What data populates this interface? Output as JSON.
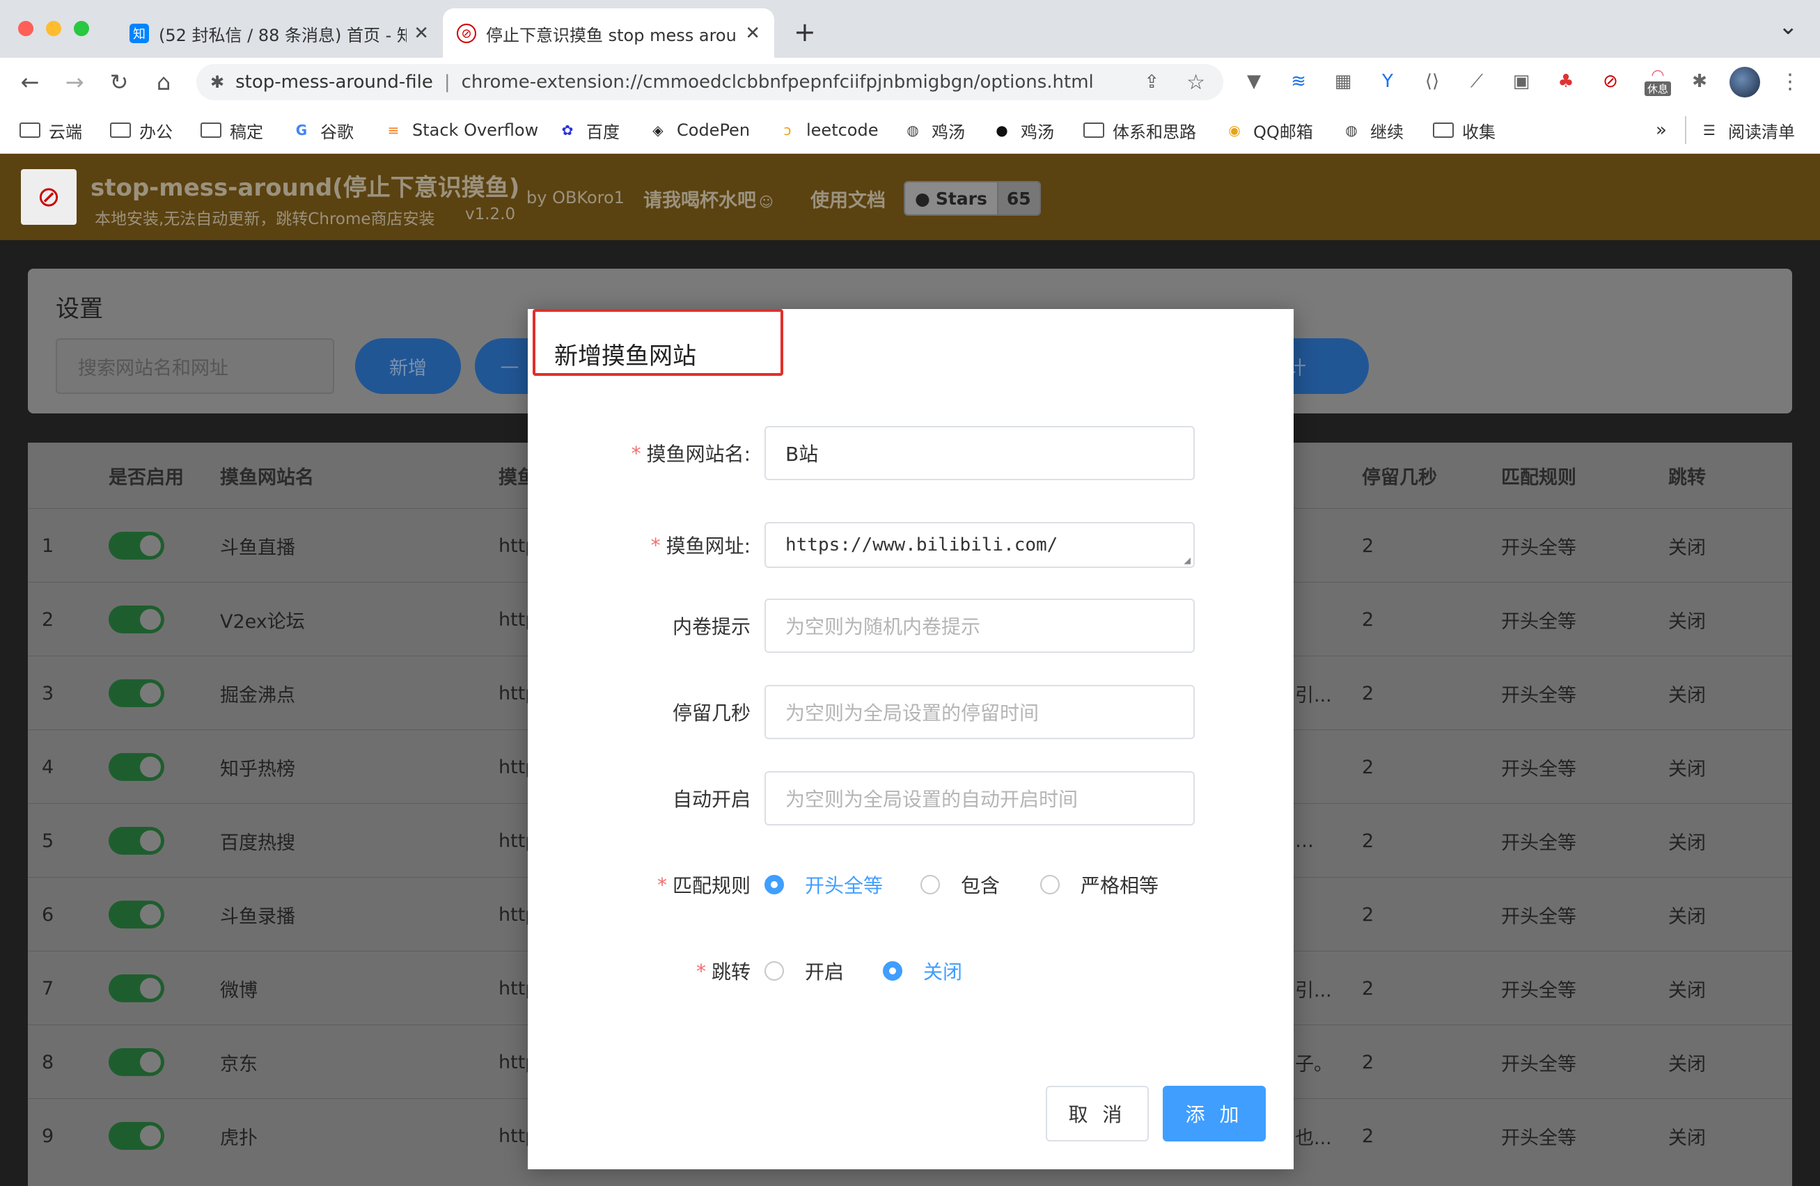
{
  "browser": {
    "tabs": [
      {
        "title": "(52 封私信 / 88 条消息) 首页 - 知",
        "favicon": "知"
      },
      {
        "title": "停止下意识摸鱼 stop mess arou",
        "favicon": "stop-icon"
      }
    ],
    "new_tab": "+",
    "dropdown": "⌄",
    "url_site": "stop-mess-around-file",
    "url_path": "chrome-extension://cmmoedclcbbnfpepnfciifpjnbmigbgn/options.html",
    "ext_badge": "休息"
  },
  "bookmarks": [
    {
      "label": "云端",
      "icon": "folder"
    },
    {
      "label": "办公",
      "icon": "folder"
    },
    {
      "label": "稿定",
      "icon": "folder"
    },
    {
      "label": "谷歌",
      "icon": "G"
    },
    {
      "label": "Stack Overflow",
      "icon": "stackoverflow"
    },
    {
      "label": "百度",
      "icon": "baidu"
    },
    {
      "label": "CodePen",
      "icon": "codepen"
    },
    {
      "label": "leetcode",
      "icon": "leetcode"
    },
    {
      "label": "鸡汤",
      "icon": "globe"
    },
    {
      "label": "鸡汤",
      "icon": "github"
    },
    {
      "label": "体系和思路",
      "icon": "folder"
    },
    {
      "label": "QQ邮箱",
      "icon": "qqmail"
    },
    {
      "label": "继续",
      "icon": "globe"
    },
    {
      "label": "收集",
      "icon": "folder"
    }
  ],
  "bookmarks_more": "»",
  "reading_list": "阅读清单",
  "app": {
    "title": "stop-mess-around(停止下意识摸鱼)",
    "subtitle": "本地安装,无法自动更新，跳转Chrome商店安装",
    "version": "v1.2.0",
    "author": "by OBKoro1",
    "coffee": "请我喝杯水吧",
    "docs": "使用文档",
    "stars_label": "Stars",
    "stars_count": "65"
  },
  "settings": {
    "title": "设置",
    "search_placeholder": "搜索网站名和网址",
    "add_button": "新增",
    "partial_button": "—",
    "stats_button": "统计"
  },
  "table": {
    "headers": [
      "是否启用",
      "摸鱼网站名",
      "摸鱼",
      "停留几秒",
      "匹配规则",
      "跳转"
    ],
    "rows": [
      {
        "idx": "1",
        "name": "斗鱼直播",
        "url": "http",
        "extra": "",
        "secs": "2",
        "rule": "开头全等",
        "jump": "关闭"
      },
      {
        "idx": "2",
        "name": "V2ex论坛",
        "url": "http",
        "extra": "",
        "secs": "2",
        "rule": "开头全等",
        "jump": "关闭"
      },
      {
        "idx": "3",
        "name": "掘金沸点",
        "url": "http",
        "extra": "引...",
        "secs": "2",
        "rule": "开头全等",
        "jump": "关闭"
      },
      {
        "idx": "4",
        "name": "知乎热榜",
        "url": "http",
        "extra": "",
        "secs": "2",
        "rule": "开头全等",
        "jump": "关闭"
      },
      {
        "idx": "5",
        "name": "百度热搜",
        "url": "http",
        "extra": "…",
        "secs": "2",
        "rule": "开头全等",
        "jump": "关闭"
      },
      {
        "idx": "6",
        "name": "斗鱼录播",
        "url": "http",
        "extra": "",
        "secs": "2",
        "rule": "开头全等",
        "jump": "关闭"
      },
      {
        "idx": "7",
        "name": "微博",
        "url": "http",
        "extra": "引...",
        "secs": "2",
        "rule": "开头全等",
        "jump": "关闭"
      },
      {
        "idx": "8",
        "name": "京东",
        "url": "http",
        "extra": "子。",
        "secs": "2",
        "rule": "开头全等",
        "jump": "关闭"
      },
      {
        "idx": "9",
        "name": "虎扑",
        "url": "http",
        "extra": "也...",
        "secs": "2",
        "rule": "开头全等",
        "jump": "关闭"
      }
    ]
  },
  "modal": {
    "title": "新增摸鱼网站",
    "fields": {
      "name_label": "摸鱼网站名:",
      "name_value": "B站",
      "url_label": "摸鱼网址:",
      "url_value": "https://www.bilibili.com/",
      "hint_label": "内卷提示",
      "hint_placeholder": "为空则为随机内卷提示",
      "stay_label": "停留几秒",
      "stay_placeholder": "为空则为全局设置的停留时间",
      "auto_label": "自动开启",
      "auto_placeholder": "为空则为全局设置的自动开启时间",
      "rule_label": "匹配规则",
      "rule_options": [
        "开头全等",
        "包含",
        "严格相等"
      ],
      "rule_selected": "开头全等",
      "jump_label": "跳转",
      "jump_options": [
        "开启",
        "关闭"
      ],
      "jump_selected": "关闭"
    },
    "cancel": "取 消",
    "submit": "添 加",
    "primary_color": "#409eff",
    "required_color": "#f56c6c"
  }
}
